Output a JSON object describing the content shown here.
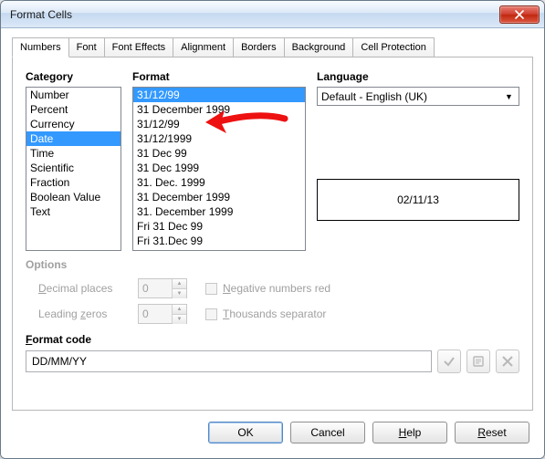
{
  "window": {
    "title": "Format Cells"
  },
  "tabs": [
    "Numbers",
    "Font",
    "Font Effects",
    "Alignment",
    "Borders",
    "Background",
    "Cell Protection"
  ],
  "active_tab": 0,
  "category": {
    "label": "Category",
    "items": [
      "Number",
      "Percent",
      "Currency",
      "Date",
      "Time",
      "Scientific",
      "Fraction",
      "Boolean Value",
      "Text"
    ],
    "selected_index": 3
  },
  "format": {
    "label": "Format",
    "items": [
      "31/12/99",
      "31 December 1999",
      "31/12/99",
      "31/12/1999",
      "31 Dec 99",
      "31 Dec 1999",
      "31. Dec. 1999",
      "31 December 1999",
      "31. December 1999",
      "Fri 31 Dec 99",
      "Fri 31.Dec 99"
    ],
    "selected_index": 0
  },
  "language": {
    "label": "Language",
    "value": "Default - English (UK)"
  },
  "preview": "02/11/13",
  "options": {
    "label": "Options",
    "decimal_label": "Decimal places",
    "decimal_value": "0",
    "leading_label": "Leading zeros",
    "leading_value": "0",
    "negative_label": "Negative numbers red",
    "thousands_label": "Thousands separator"
  },
  "format_code": {
    "label": "Format code",
    "value": "DD/MM/YY"
  },
  "footer": {
    "ok": "OK",
    "cancel": "Cancel",
    "help": "Help",
    "reset": "Reset"
  }
}
